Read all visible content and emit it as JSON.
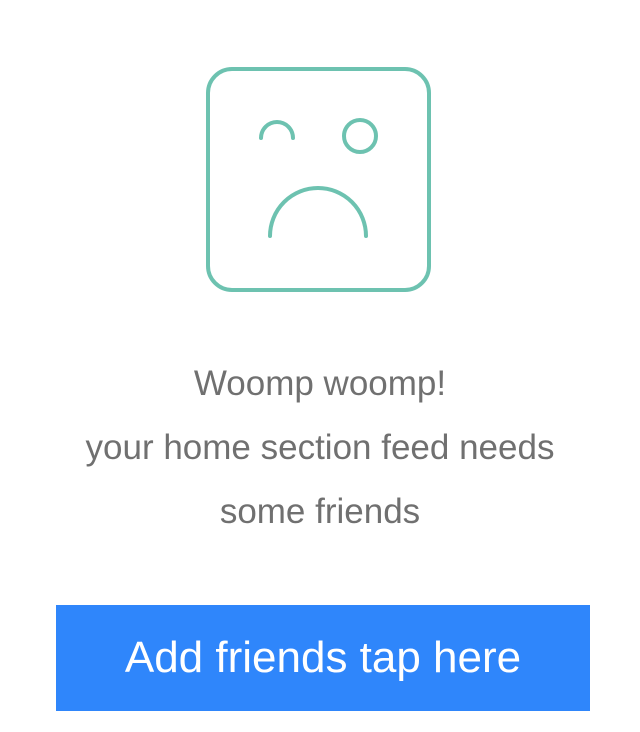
{
  "empty_state": {
    "icon": "sad-face-icon",
    "accent_color": "#6dc2b0",
    "title": "Woomp woomp!",
    "message_line_1": "your home section feed needs",
    "message_line_2": "some friends"
  },
  "cta": {
    "label": "Add friends tap here",
    "background_color": "#2f86fb"
  }
}
